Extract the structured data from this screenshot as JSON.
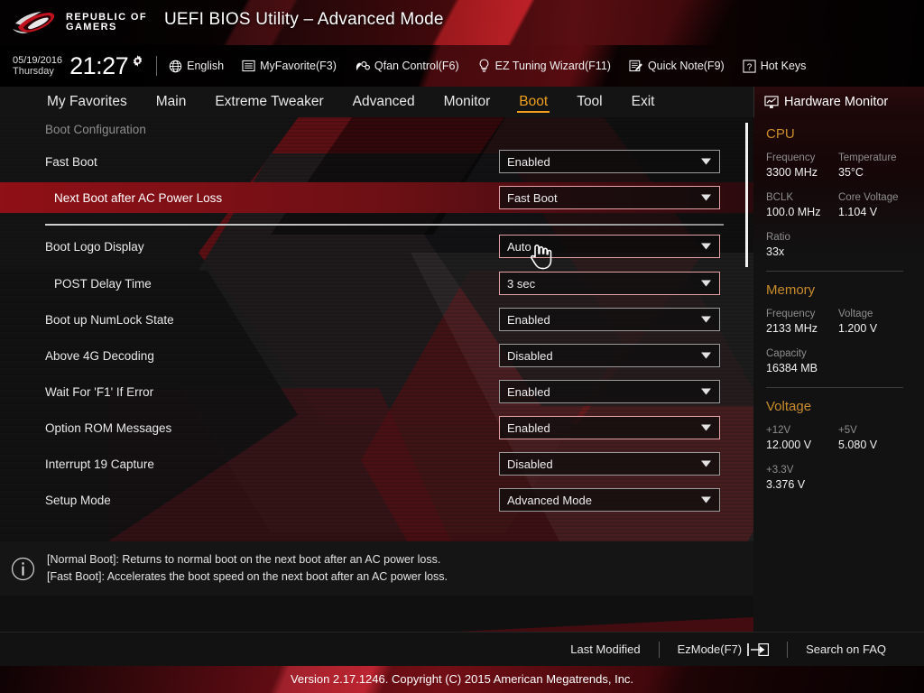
{
  "header": {
    "brand_line1": "REPUBLIC OF",
    "brand_line2": "GAMERS",
    "title": "UEFI BIOS Utility – Advanced Mode",
    "date": "05/19/2016",
    "weekday": "Thursday",
    "time": "21:27",
    "toolbar": [
      {
        "label": "English",
        "icon": "globe-icon"
      },
      {
        "label": "MyFavorite(F3)",
        "icon": "list-icon"
      },
      {
        "label": "Qfan Control(F6)",
        "icon": "fan-icon"
      },
      {
        "label": "EZ Tuning Wizard(F11)",
        "icon": "bulb-icon"
      },
      {
        "label": "Quick Note(F9)",
        "icon": "note-pencil-icon"
      },
      {
        "label": "Hot Keys",
        "icon": "question-box-icon"
      }
    ]
  },
  "nav": {
    "tabs": [
      {
        "label": "My Favorites",
        "active": false
      },
      {
        "label": "Main",
        "active": false
      },
      {
        "label": "Extreme Tweaker",
        "active": false
      },
      {
        "label": "Advanced",
        "active": false
      },
      {
        "label": "Monitor",
        "active": false
      },
      {
        "label": "Boot",
        "active": true
      },
      {
        "label": "Tool",
        "active": false
      },
      {
        "label": "Exit",
        "active": false
      }
    ],
    "active_tab": "Boot",
    "accent_color": "#f0a01e",
    "hardware_monitor_label": "Hardware Monitor"
  },
  "main": {
    "section_title": "Boot Configuration",
    "rows": [
      {
        "label": "Fast Boot",
        "value": "Enabled",
        "indent": false,
        "selected": false
      },
      {
        "label": "Next Boot after AC Power Loss",
        "value": "Fast Boot",
        "indent": true,
        "selected": true
      },
      {
        "label": "Boot Logo Display",
        "value": "Auto",
        "indent": false,
        "selected": false
      },
      {
        "label": "POST Delay Time",
        "value": "3 sec",
        "indent": true,
        "selected": false
      },
      {
        "label": "Boot up NumLock State",
        "value": "Enabled",
        "indent": false,
        "selected": false
      },
      {
        "label": "Above 4G Decoding",
        "value": "Disabled",
        "indent": false,
        "selected": false
      },
      {
        "label": "Wait For 'F1' If Error",
        "value": "Enabled",
        "indent": false,
        "selected": false
      },
      {
        "label": "Option ROM Messages",
        "value": "Enabled",
        "indent": false,
        "selected": false
      },
      {
        "label": "Interrupt 19 Capture",
        "value": "Disabled",
        "indent": false,
        "selected": false
      },
      {
        "label": "Setup Mode",
        "value": "Advanced Mode",
        "indent": false,
        "selected": false
      }
    ],
    "help_line1": "[Normal Boot]: Returns to normal boot on the next boot after an AC power loss.",
    "help_line2": "[Fast Boot]: Accelerates the boot speed on the next boot after an AC power loss."
  },
  "sidebar": {
    "cpu": {
      "title": "CPU",
      "frequency_label": "Frequency",
      "frequency_value": "3300 MHz",
      "temperature_label": "Temperature",
      "temperature_value": "35°C",
      "bclk_label": "BCLK",
      "bclk_value": "100.0 MHz",
      "core_voltage_label": "Core Voltage",
      "core_voltage_value": "1.104 V",
      "ratio_label": "Ratio",
      "ratio_value": "33x"
    },
    "memory": {
      "title": "Memory",
      "frequency_label": "Frequency",
      "frequency_value": "2133 MHz",
      "voltage_label": "Voltage",
      "voltage_value": "1.200 V",
      "capacity_label": "Capacity",
      "capacity_value": "16384 MB"
    },
    "voltage": {
      "title": "Voltage",
      "v12_label": "+12V",
      "v12_value": "12.000 V",
      "v5_label": "+5V",
      "v5_value": "5.080 V",
      "v33_label": "+3.3V",
      "v33_value": "3.376 V"
    },
    "accent_color": "#c98c2a"
  },
  "footer": {
    "last_modified": "Last Modified",
    "ez_mode": "EzMode(F7)",
    "search_faq": "Search on FAQ",
    "version": "Version 2.17.1246. Copyright (C) 2015 American Megatrends, Inc."
  }
}
